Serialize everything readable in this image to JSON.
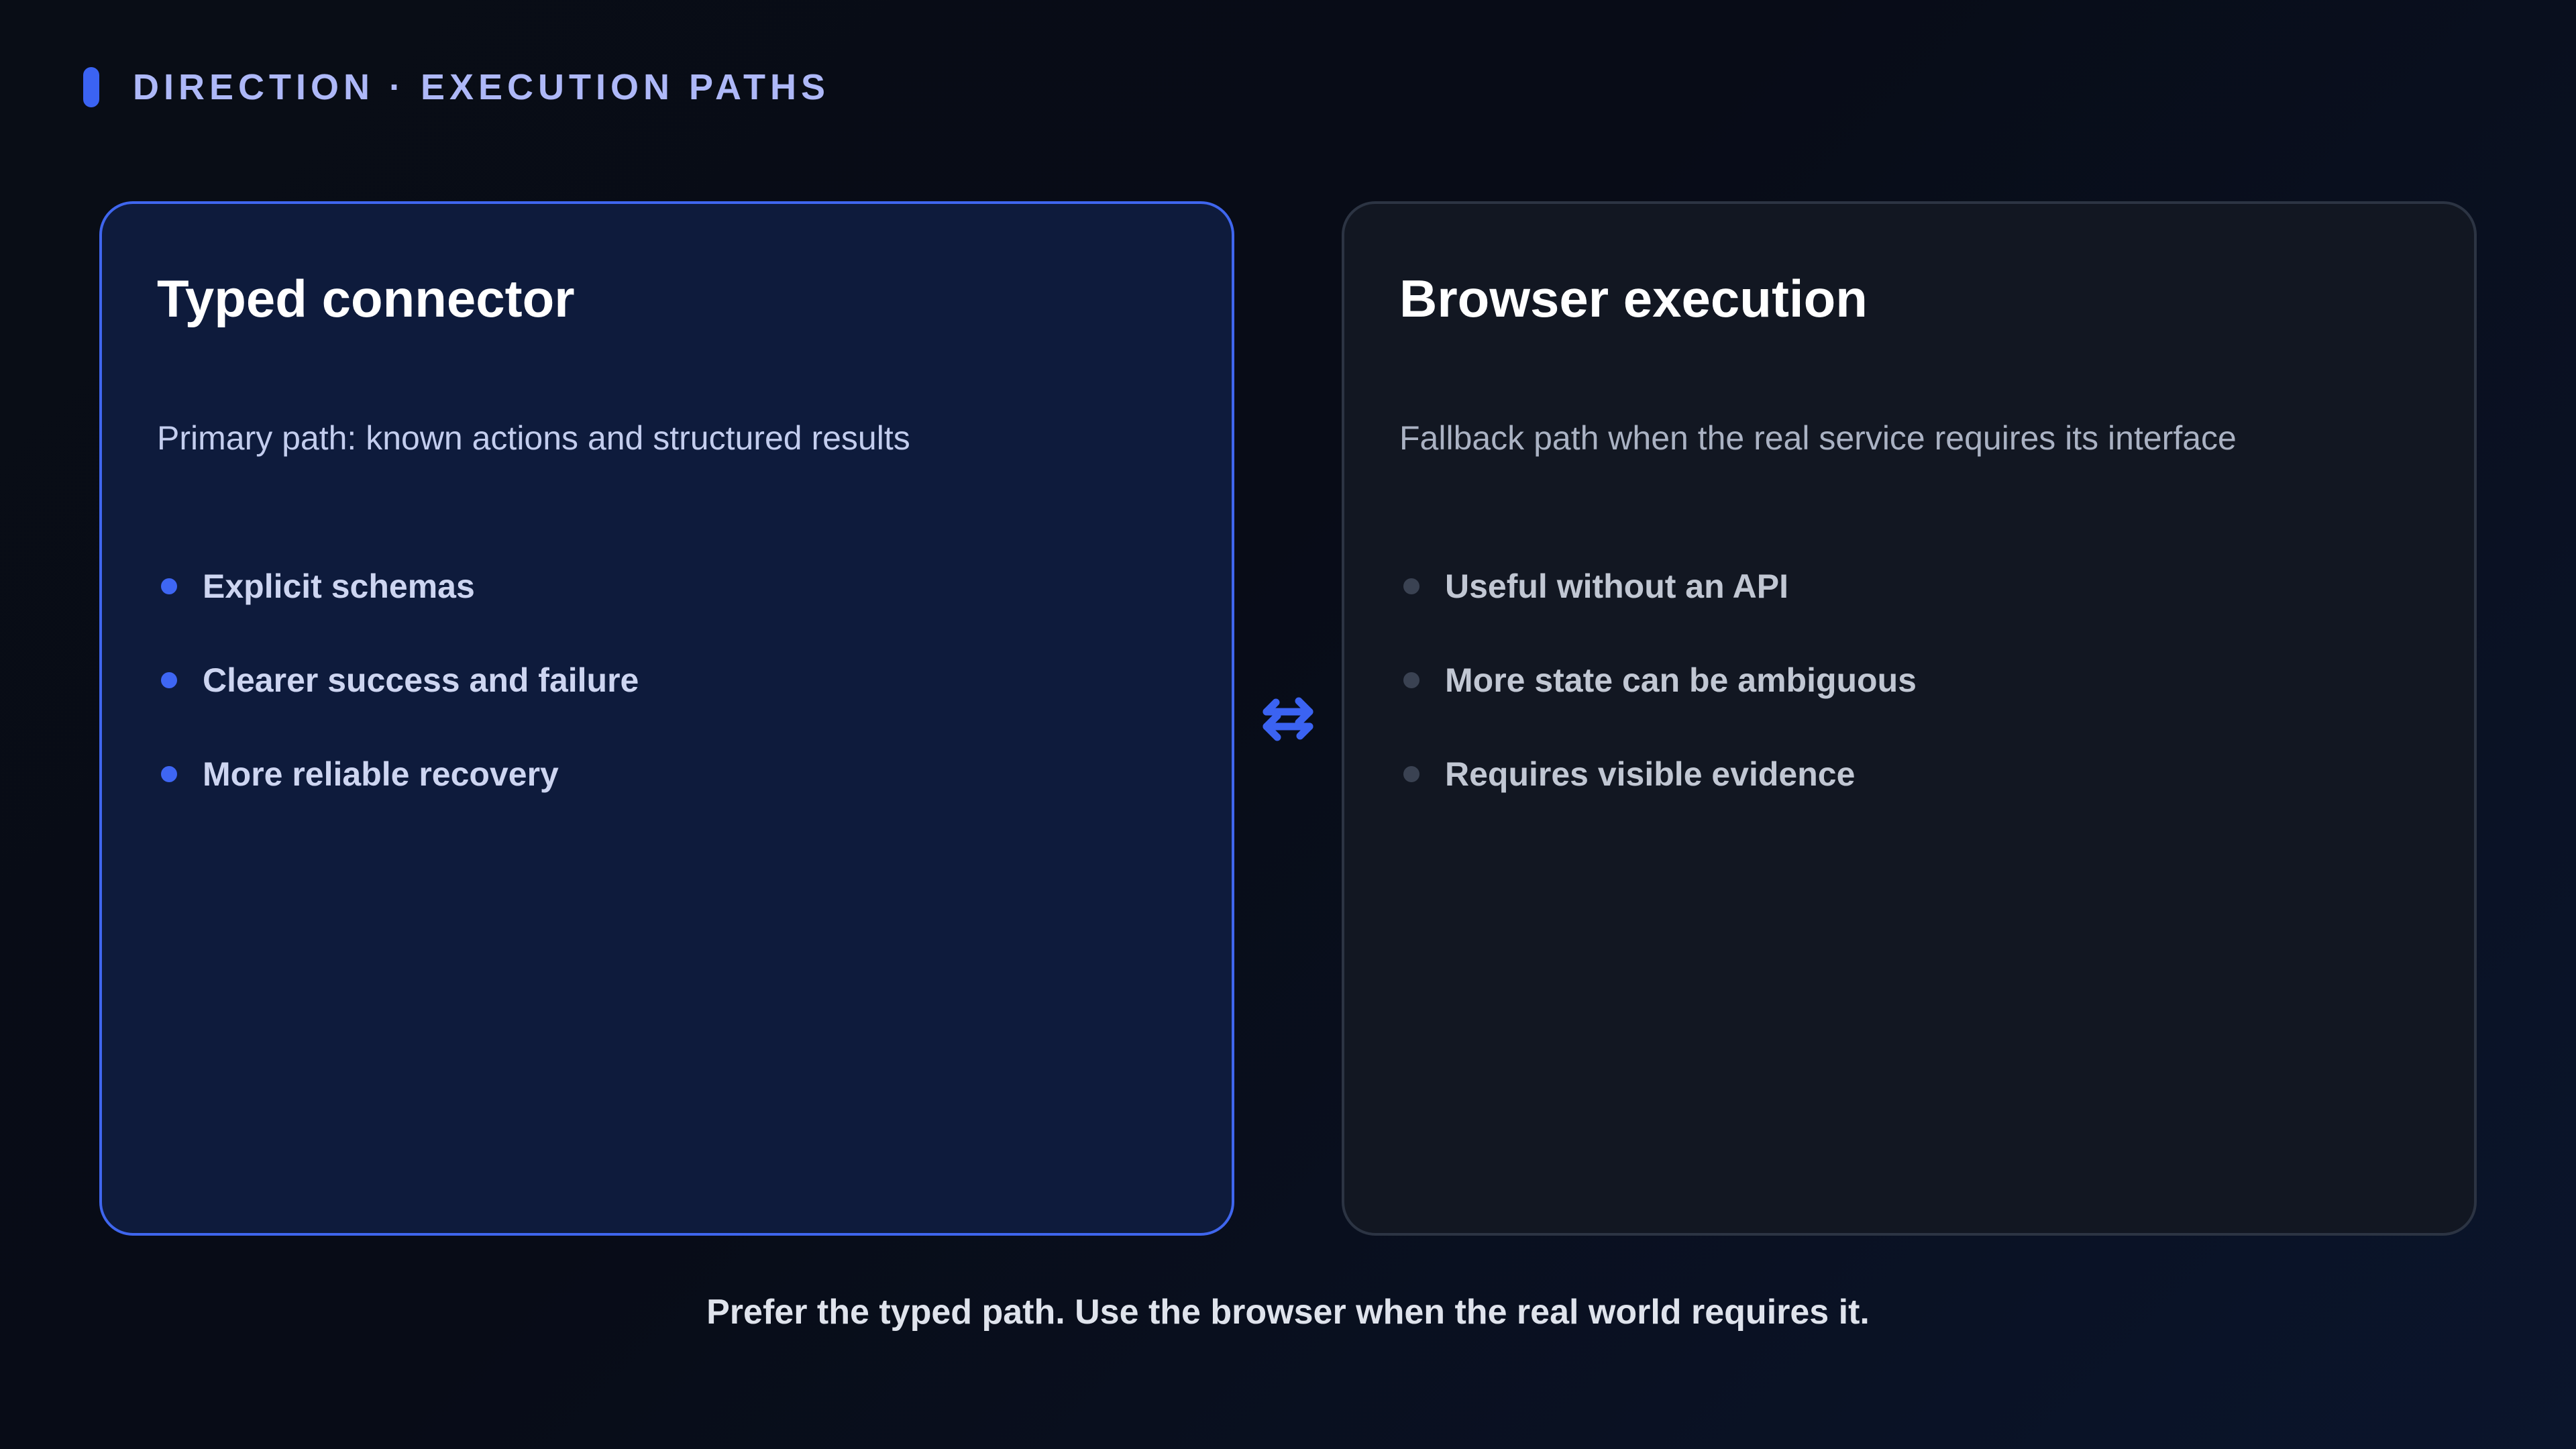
{
  "header": {
    "label": "DIRECTION · EXECUTION PATHS"
  },
  "cards": {
    "primary": {
      "title": "Typed connector",
      "subtitle": "Primary path: known actions and structured results",
      "bullets": [
        "Explicit schemas",
        "Clearer success and failure",
        "More reliable recovery"
      ]
    },
    "fallback": {
      "title": "Browser execution",
      "subtitle": "Fallback path when the real service requires its interface",
      "bullets": [
        "Useful without an API",
        "More state can be ambiguous",
        "Requires visible evidence"
      ]
    }
  },
  "icons": {
    "between_cards": "swap-arrows-icon"
  },
  "footer": {
    "text": "Prefer the typed path. Use the browser when the real world requires it."
  },
  "colors": {
    "accent": "#3b63f2",
    "header_text": "#aeb8f8",
    "background": "#080c17",
    "primary_card_bg": "#0e1b3c",
    "fallback_card_bg": "#121722"
  }
}
